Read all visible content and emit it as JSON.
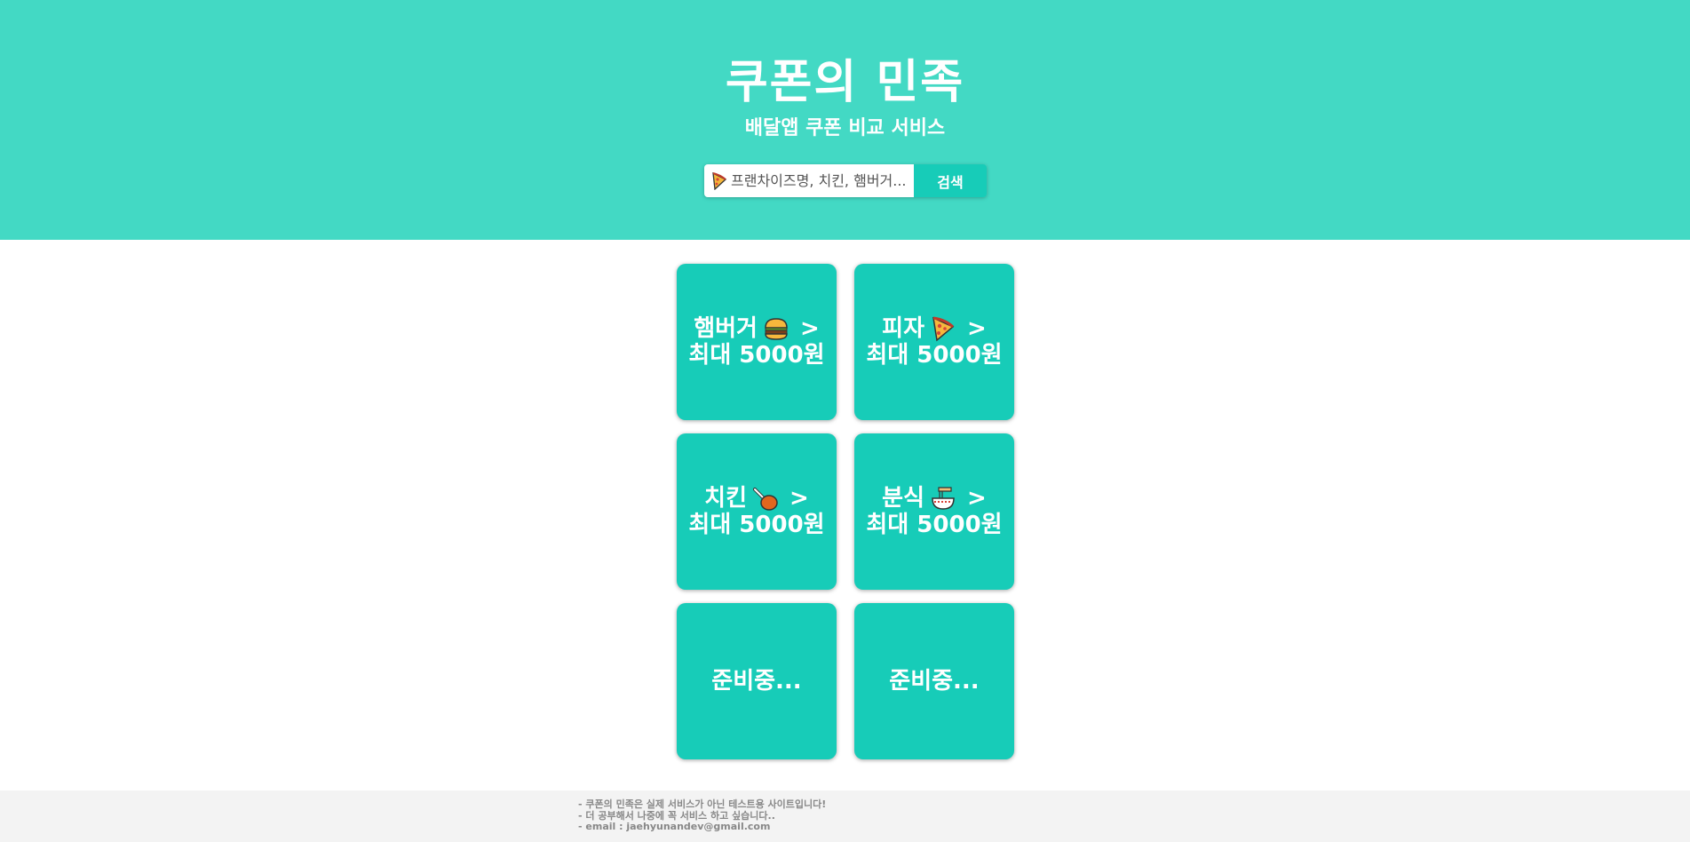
{
  "header": {
    "title": "쿠폰의 민족",
    "subtitle": "배달앱 쿠폰 비교 서비스",
    "background": "#43d9c4"
  },
  "search": {
    "placeholder": "프랜차이즈명, 치킨, 햄버거...",
    "button_label": "검색",
    "icon": "pizza-icon"
  },
  "cards": [
    {
      "label": "햄버거",
      "icon": "hamburger-icon",
      "arrow": ">",
      "discount": "최대 5000원"
    },
    {
      "label": "피자",
      "icon": "pizza-icon",
      "arrow": ">",
      "discount": "최대 5000원"
    },
    {
      "label": "치킨",
      "icon": "chicken-leg-icon",
      "arrow": ">",
      "discount": "최대 5000원"
    },
    {
      "label": "분식",
      "icon": "noodle-bowl-icon",
      "arrow": ">",
      "discount": "최대 5000원"
    },
    {
      "label": "준비중..."
    },
    {
      "label": "준비중..."
    }
  ],
  "card_color": "#17ccb8",
  "footer": {
    "lines": [
      "- 쿠폰의 민족은 실제 서비스가 아닌 테스트용 사이트입니다!",
      "- 더 공부해서 나중에 꼭 서비스 하고 싶습니다..",
      "- email : jaehyunandev@gmail.com"
    ]
  }
}
